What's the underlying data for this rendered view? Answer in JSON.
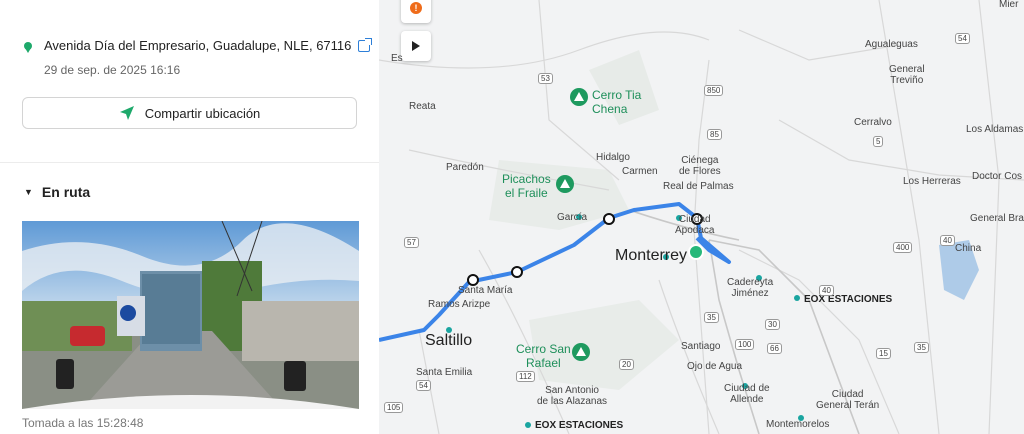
{
  "location": {
    "address": "Avenida Día del Empresario, Guadalupe, NLE, 67116",
    "date": "29 de sep. de 2025 16:16"
  },
  "share_label": "Compartir ubicación",
  "route_section": {
    "title": "En ruta",
    "taken_text": "Tomada a las 15:28:48"
  },
  "map": {
    "labels": {
      "mier": "Mier",
      "es": "Es",
      "agualeguas": "Agualeguas",
      "general_trevino": "General\nTreviño",
      "reata": "Reata",
      "cerro_tia_chena": "Cerro Tia\nChena",
      "cerralvo": "Cerralvo",
      "los_aldamas": "Los Aldamas",
      "hidalgo": "Hidalgo",
      "cienega_de_flores": "Ciénega\nde Flores",
      "paredon": "Paredón",
      "carmen": "Carmen",
      "los_herreras": "Los Herreras",
      "doctor_cos": "Doctor Cos",
      "picachos": "Picachos\nel Fraile",
      "real_de_palmas": "Real de Palmas",
      "garcia": "García",
      "ciudad_apodaca": "Ciudad\nApodaca",
      "general_bravo": "General Bravo",
      "china": "China",
      "monterrey": "Monterrey",
      "santa_maria": "Santa María",
      "ramos_arizpe": "Ramos Arizpe",
      "cadereyta": "Cadereyta\nJiménez",
      "eox1": "EOX ESTACIONES",
      "saltillo": "Saltillo",
      "cerro_san_rafael": "Cerro San\nRafael",
      "santiago": "Santiago",
      "ojo_de_agua": "Ojo de Agua",
      "santa_emilia": "Santa Emilia",
      "san_antonio": "San Antonio\nde las Alazanas",
      "ciudad_de_allende": "Ciudad de\nAllende",
      "ciudad_general_teran": "Ciudad\nGeneral Terán",
      "eox2": "EOX ESTACIONES",
      "montemorelos": "Montemorelos"
    },
    "shields": [
      "54",
      "53",
      "850",
      "85",
      "5",
      "57",
      "40",
      "400",
      "40",
      "35",
      "30",
      "66",
      "100",
      "15",
      "35",
      "20",
      "112",
      "54",
      "105"
    ]
  }
}
